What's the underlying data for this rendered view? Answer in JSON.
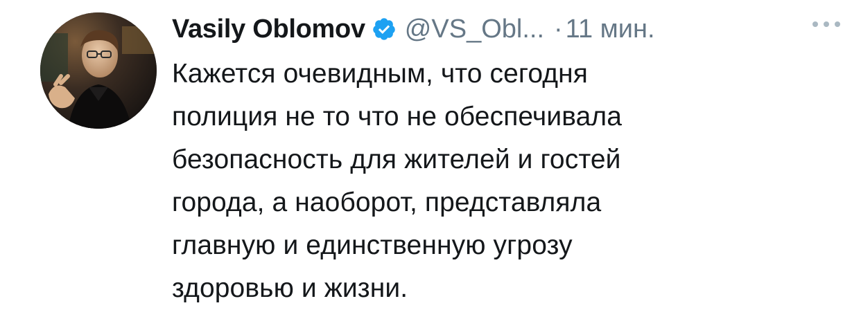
{
  "tweet": {
    "author": {
      "display_name": "Vasily Oblomov",
      "handle": "@VS_Obl...",
      "verified": true,
      "avatar_icon": "profile-photo"
    },
    "separator": "·",
    "time": "11 мин.",
    "more_icon": "ellipsis-icon",
    "text_lines": [
      "Кажется очевидным, что сегодня",
      "полиция не то что не обеспечивала",
      "безопасность для жителей и гостей",
      "города, а наоборот, представляла",
      "главную и единственную угрозу",
      "здоровью и жизни."
    ],
    "colors": {
      "name": "#14171a",
      "meta": "#657786",
      "verified_badge": "#1da1f2",
      "more_dots": "#aab8c2"
    }
  }
}
